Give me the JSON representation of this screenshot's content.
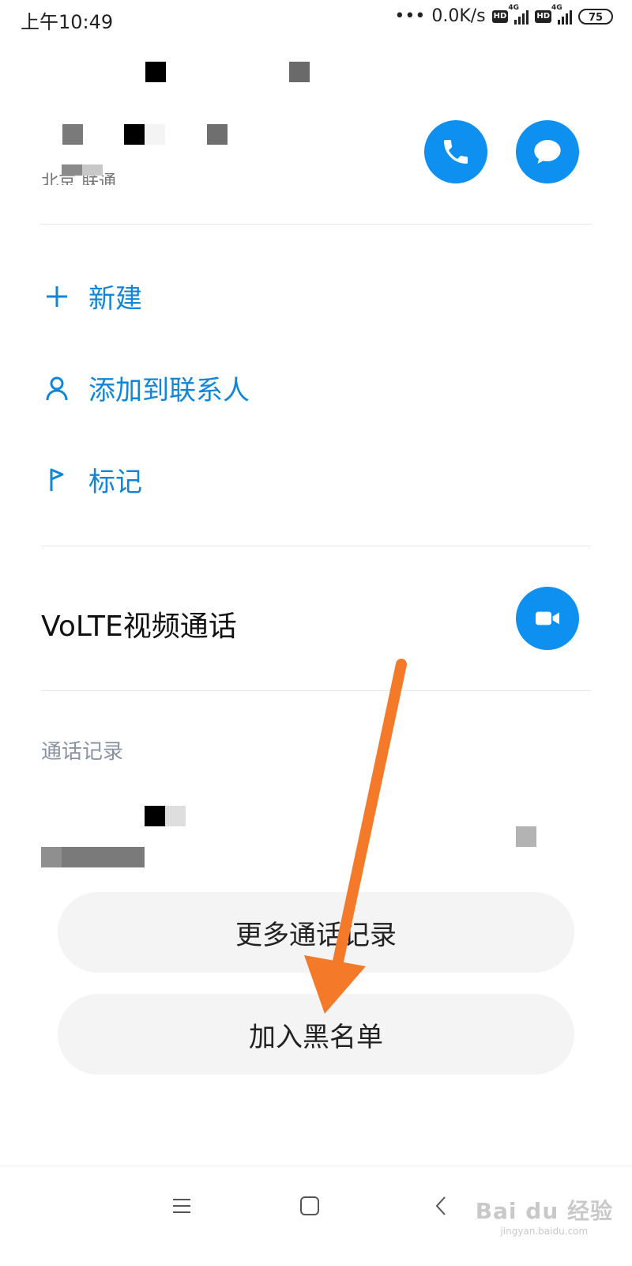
{
  "status_bar": {
    "time": "上午10:49",
    "net_speed": "0.0K/s",
    "hd_label": "HD",
    "network_label": "4G",
    "battery": "75"
  },
  "contact": {
    "location_partial": "北京 联通"
  },
  "actions": [
    {
      "label": "新建",
      "icon": "plus-icon"
    },
    {
      "label": "添加到联系人",
      "icon": "person-icon"
    },
    {
      "label": "标记",
      "icon": "flag-icon"
    }
  ],
  "volte": {
    "label": "VoLTE视频通话"
  },
  "call_log": {
    "section_title": "通话记录"
  },
  "buttons": {
    "more_calls": "更多通话记录",
    "blacklist": "加入黑名单"
  },
  "watermark": {
    "main": "Bai du 经验",
    "sub": "jingyan.baidu.com"
  },
  "colors": {
    "accent": "#0d90f0",
    "link_text": "#0f86d8",
    "annotation_arrow": "#f47a2a"
  }
}
